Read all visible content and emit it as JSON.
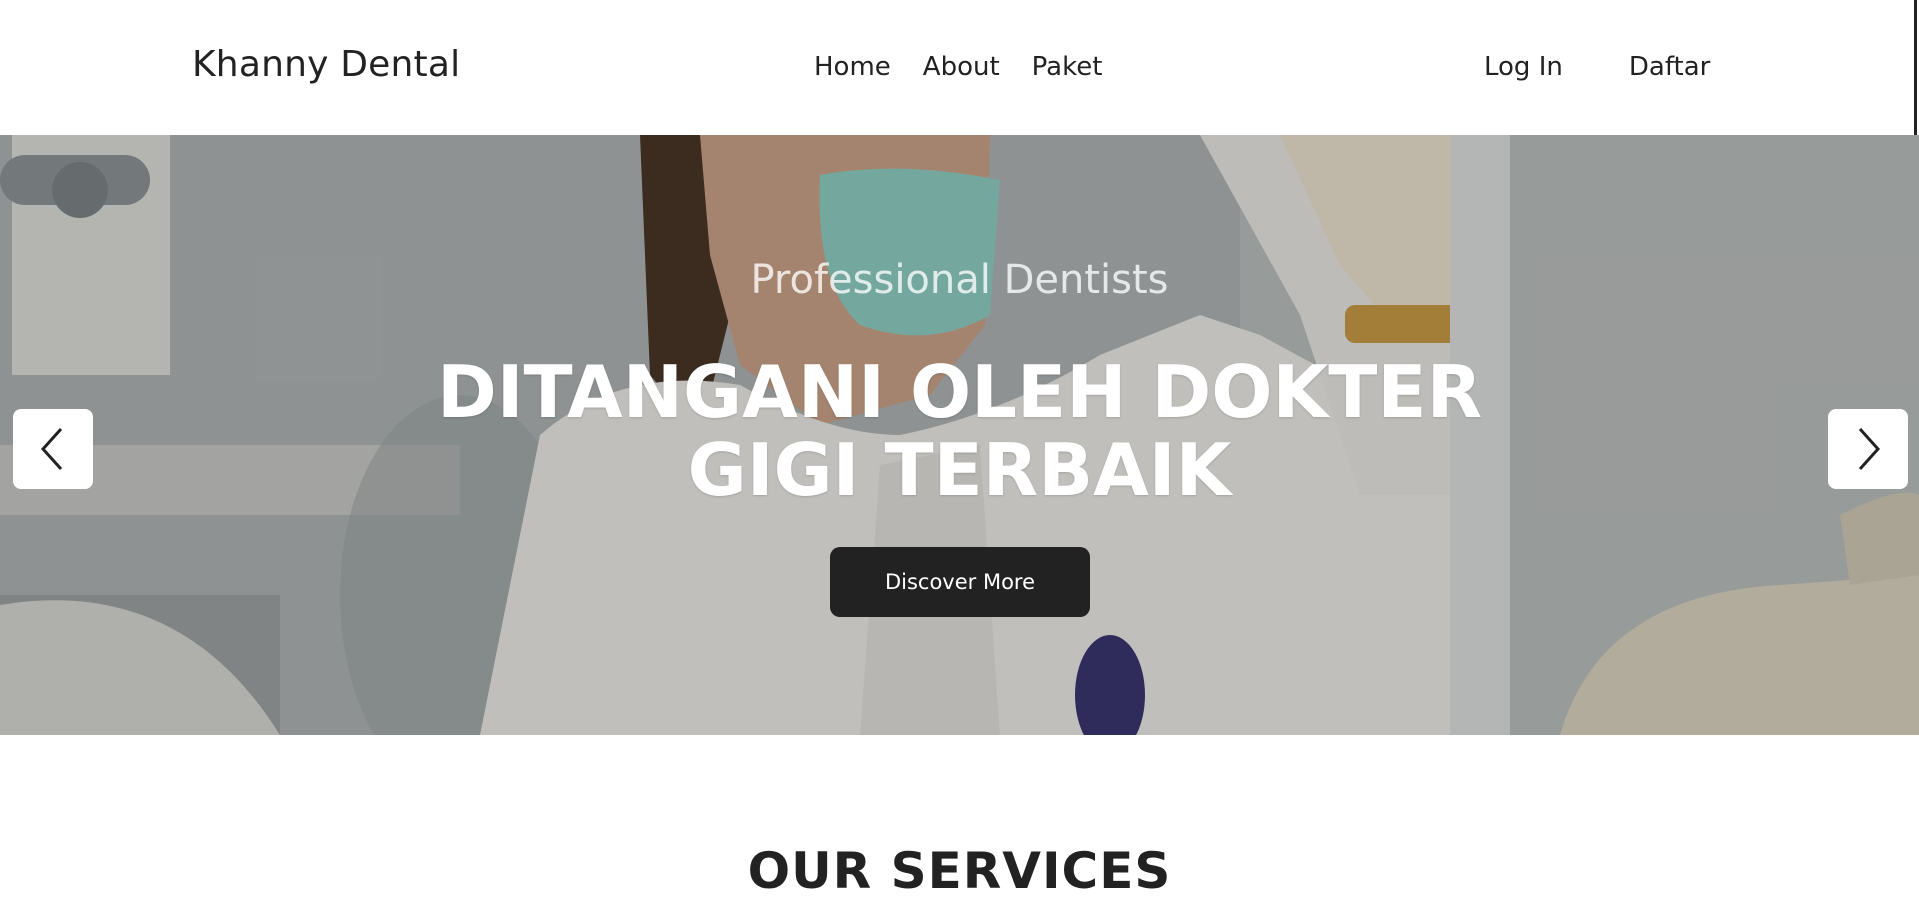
{
  "header": {
    "brand": "Khanny Dental",
    "nav": [
      "Home",
      "About",
      "Paket"
    ],
    "login": "Log In",
    "register": "Daftar"
  },
  "hero": {
    "subtitle": "Professional Dentists",
    "title": "DITANGANI OLEH DOKTER GIGI TERBAIK",
    "cta": "Discover More",
    "prev_icon": "chevron-left-icon",
    "next_icon": "chevron-right-icon"
  },
  "services": {
    "title": "OUR SERVICES"
  },
  "colors": {
    "dark": "#222222",
    "white": "#ffffff"
  }
}
